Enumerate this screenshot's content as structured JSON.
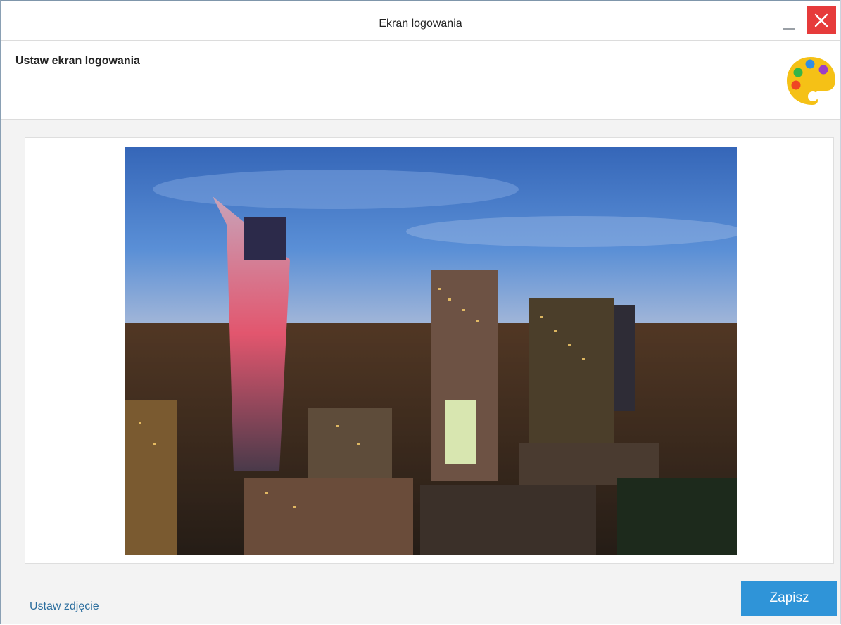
{
  "window": {
    "title": "Ekran logowania"
  },
  "header": {
    "title": "Ustaw ekran logowania",
    "icon": "palette-icon"
  },
  "main": {
    "image": "city-skyline-night-photo"
  },
  "footer": {
    "set_photo_link": "Ustaw zdjęcie",
    "save_label": "Zapisz"
  },
  "colors": {
    "accent": "#2f94d8",
    "close": "#e63b3b",
    "link": "#2c6e9e",
    "palette": "#f5c116"
  }
}
